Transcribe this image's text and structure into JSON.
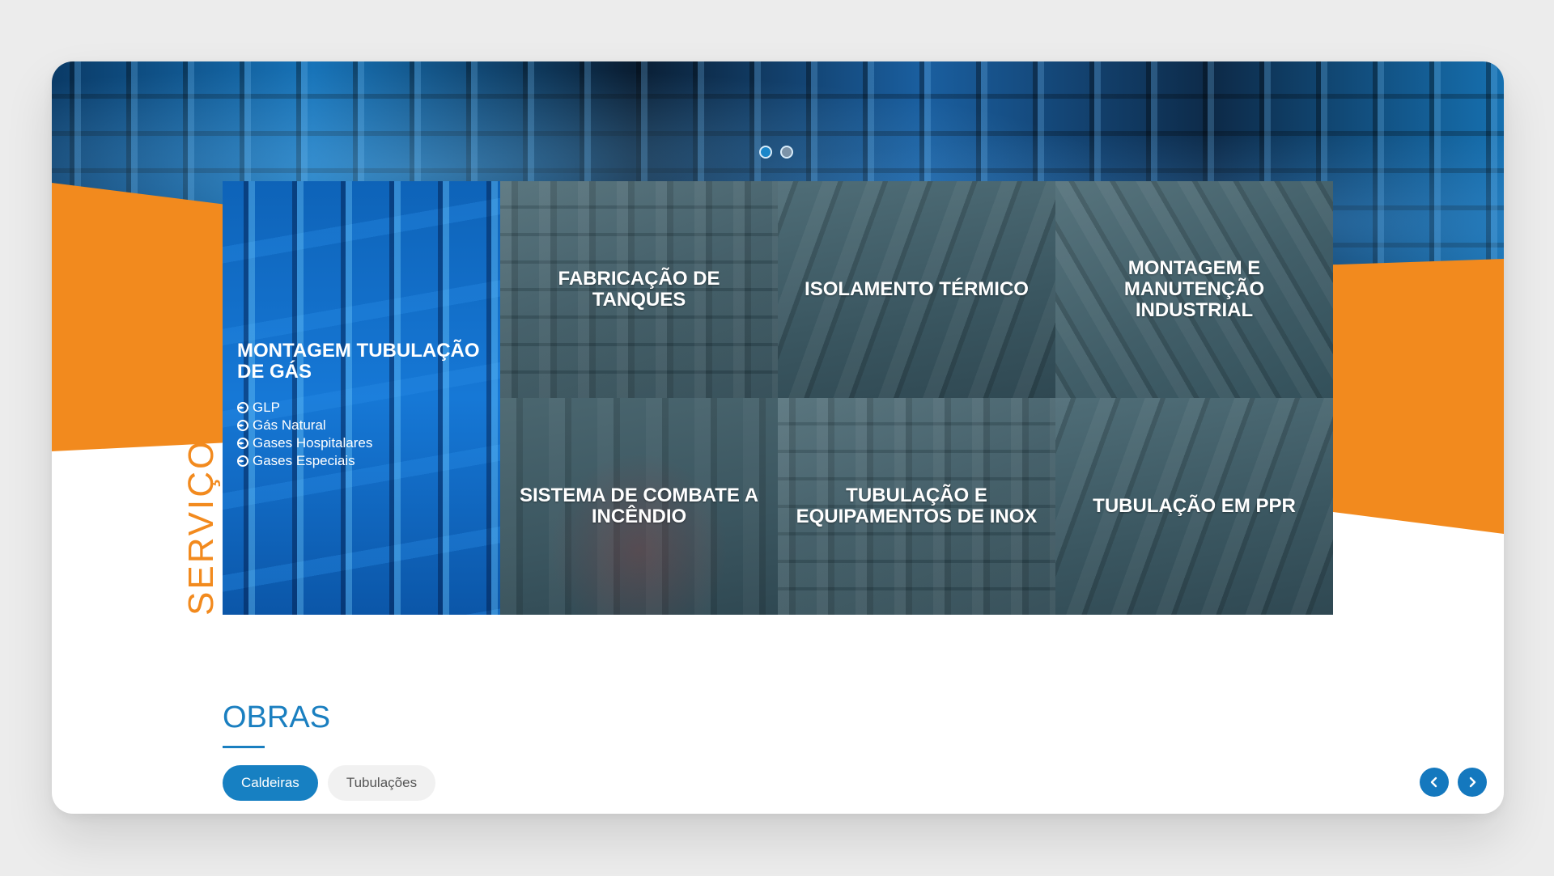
{
  "slider": {
    "dots": [
      {
        "label": "slide-1",
        "active": true
      },
      {
        "label": "slide-2",
        "active": false
      }
    ]
  },
  "colors": {
    "accent_orange": "#f28a1e",
    "accent_blue": "#1780c2",
    "tile_overlay": "#3e5a64"
  },
  "services": {
    "section_label": "SERVIÇOS",
    "featured": {
      "title": "MONTAGEM TUBULAÇÃO DE GÁS",
      "items": [
        "GLP",
        "Gás Natural",
        "Gases Hospitalares",
        "Gases Especiais"
      ],
      "item_icon": "arrow-circle-icon"
    },
    "tiles": [
      {
        "label": "FABRICAÇÃO DE TANQUES"
      },
      {
        "label": "ISOLAMENTO TÉRMICO"
      },
      {
        "label": "MONTAGEM E MANUTENÇÃO INDUSTRIAL"
      },
      {
        "label": "SISTEMA DE COMBATE A INCÊNDIO"
      },
      {
        "label": "TUBULAÇÃO E EQUIPAMENTOS DE INOX"
      },
      {
        "label": "TUBULAÇÃO EM PPR"
      }
    ]
  },
  "obras": {
    "title": "OBRAS",
    "tabs": [
      {
        "label": "Caldeiras",
        "active": true
      },
      {
        "label": "Tubulações",
        "active": false
      }
    ],
    "nav": {
      "prev_icon": "chevron-left-icon",
      "next_icon": "chevron-right-icon"
    }
  }
}
